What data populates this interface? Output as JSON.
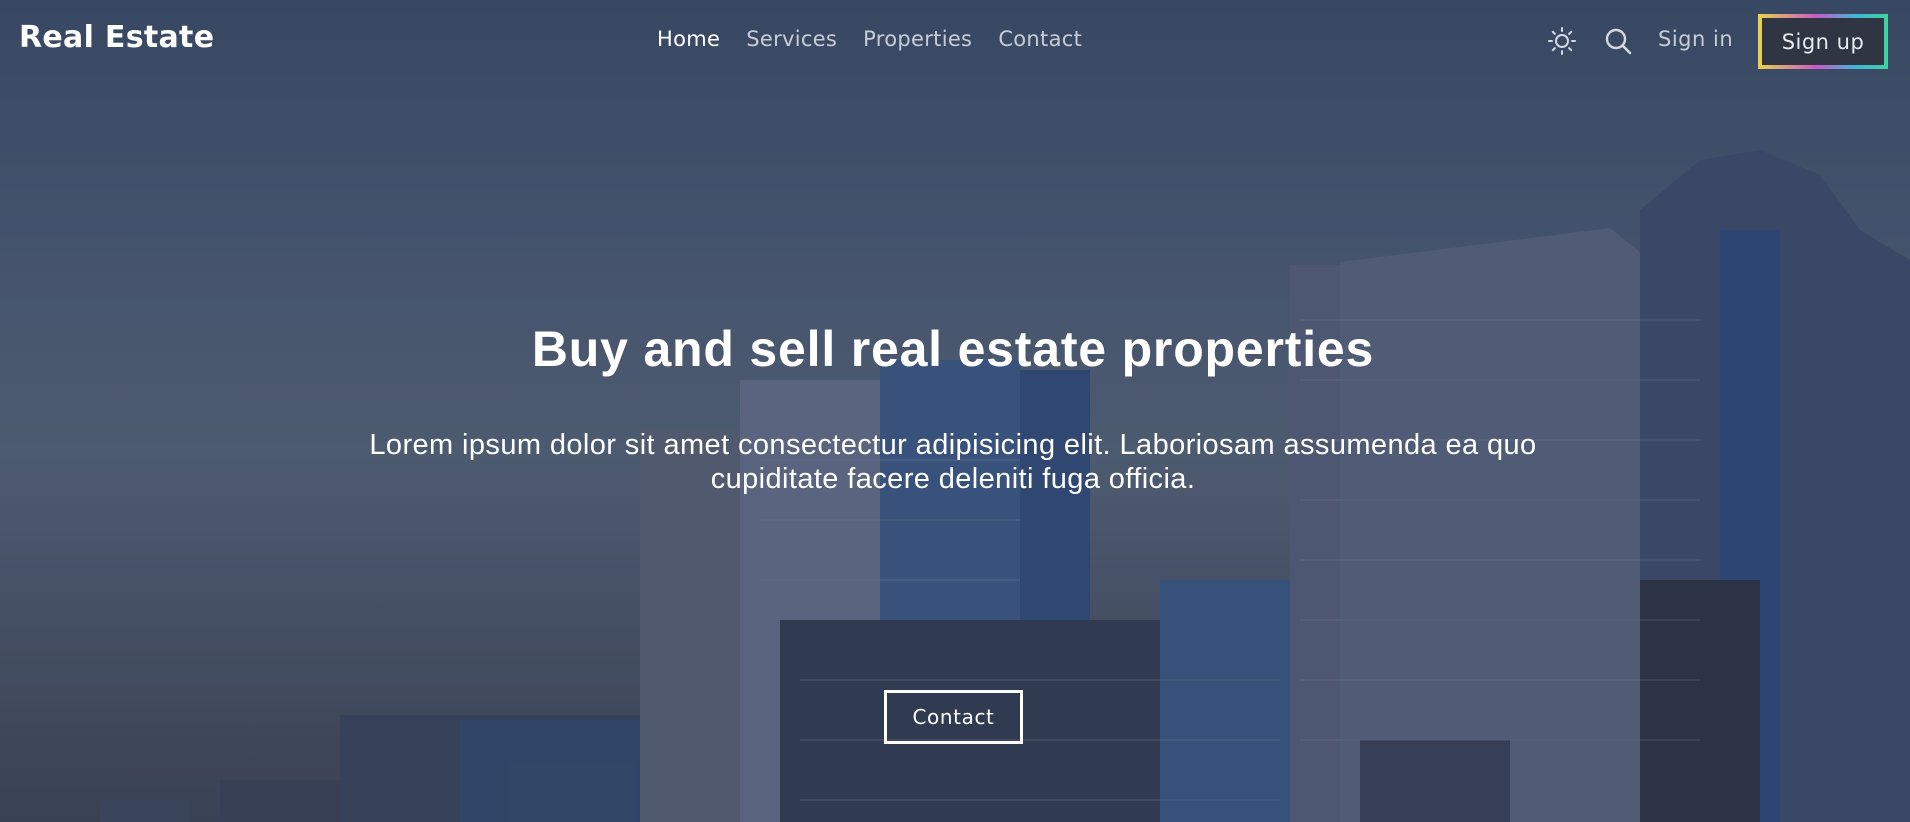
{
  "brand": {
    "logo_text": "Real Estate"
  },
  "nav": {
    "items": [
      {
        "label": "Home",
        "active": true
      },
      {
        "label": "Services",
        "active": false
      },
      {
        "label": "Properties",
        "active": false
      },
      {
        "label": "Contact",
        "active": false
      }
    ],
    "theme_toggle_icon": "sun-icon",
    "search_icon": "search-icon",
    "signin_label": "Sign in",
    "signup_label": "Sign up"
  },
  "hero": {
    "title": "Buy and sell real estate properties",
    "text": "Lorem ipsum dolor sit amet consectectur adipisicing elit. Laboriosam assumenda ea quo cupiditate facere deleniti fuga officia.",
    "cta_label": "Contact"
  },
  "colors": {
    "background": "#4b5b75",
    "text": "#ffffff",
    "nav_muted": "#c7cdd8",
    "signup_bg": "#2f3542",
    "signup_border_gradient": [
      "#e9d34a",
      "#c85ac6",
      "#3fb6d8",
      "#3ed49c"
    ]
  }
}
